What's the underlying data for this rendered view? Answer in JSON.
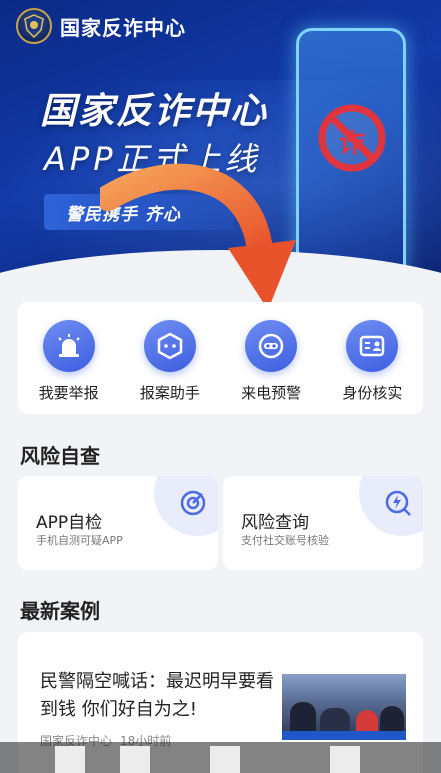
{
  "header": {
    "app_title": "国家反诈中心",
    "emblem": "police-emblem-icon"
  },
  "hero": {
    "headline": "国家反诈中心",
    "subline": "APP正式上线",
    "slogan": "警民携手 齐心",
    "phone_sign": "诈"
  },
  "actions": [
    {
      "label": "我要举报",
      "icon": "alarm-light-icon"
    },
    {
      "label": "报案助手",
      "icon": "assistant-icon"
    },
    {
      "label": "来电预警",
      "icon": "mask-icon"
    },
    {
      "label": "身份核实",
      "icon": "id-card-icon"
    }
  ],
  "risk_section": {
    "title": "风险自查",
    "cards": [
      {
        "title": "APP自检",
        "desc": "手机自测可疑APP",
        "icon": "target-check-icon"
      },
      {
        "title": "风险查询",
        "desc": "支付社交账号核验",
        "icon": "lightning-search-icon"
      }
    ]
  },
  "cases_section": {
    "title": "最新案例",
    "items": [
      {
        "text": "民警隔空喊话：最迟明早要看到钱 你们好自为之!",
        "source": "国家反诈中心",
        "time": "18小时前"
      }
    ]
  },
  "colors": {
    "hero_bg": "#123aa8",
    "accent": "#3d5fe0",
    "arrow": "#f07a3a"
  }
}
